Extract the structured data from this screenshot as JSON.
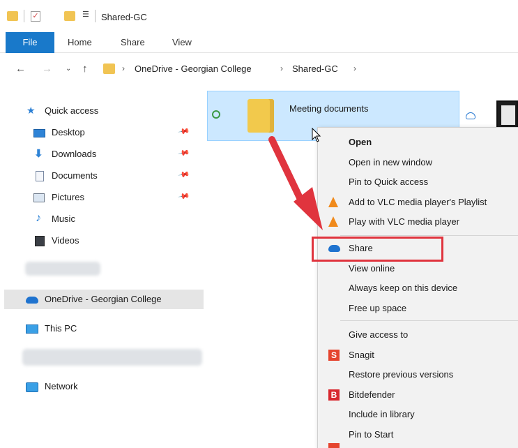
{
  "window": {
    "title": "Shared-GC"
  },
  "ribbon": {
    "tabs": [
      {
        "label": "File"
      },
      {
        "label": "Home"
      },
      {
        "label": "Share"
      },
      {
        "label": "View"
      }
    ]
  },
  "address": {
    "breadcrumbs": [
      "OneDrive - Georgian College",
      "Shared-GC"
    ]
  },
  "sidebar": {
    "items": [
      {
        "label": "Quick access",
        "icon": "star-icon"
      },
      {
        "label": "Desktop",
        "icon": "desktop-icon",
        "pinned": true
      },
      {
        "label": "Downloads",
        "icon": "download-icon",
        "pinned": true
      },
      {
        "label": "Documents",
        "icon": "documents-icon",
        "pinned": true
      },
      {
        "label": "Pictures",
        "icon": "pictures-icon",
        "pinned": true
      },
      {
        "label": "Music",
        "icon": "music-icon"
      },
      {
        "label": "Videos",
        "icon": "videos-icon"
      },
      {
        "label": "OneDrive - Georgian College",
        "icon": "onedrive-cloud-icon",
        "selected": true
      },
      {
        "label": "This PC",
        "icon": "pc-icon"
      },
      {
        "label": "Network",
        "icon": "network-icon"
      }
    ]
  },
  "content": {
    "files": [
      {
        "name": "Meeting documents",
        "type": "folder",
        "selected": true
      }
    ]
  },
  "context_menu": {
    "groups": [
      [
        {
          "label": "Open",
          "bold": true
        },
        {
          "label": "Open in new window"
        },
        {
          "label": "Pin to Quick access"
        },
        {
          "label": "Add to VLC media player's Playlist",
          "icon": "vlc-icon"
        },
        {
          "label": "Play with VLC media player",
          "icon": "vlc-icon"
        }
      ],
      [
        {
          "label": "Share",
          "icon": "onedrive-cloud-icon",
          "highlighted": true
        },
        {
          "label": "View online"
        },
        {
          "label": "Always keep on this device"
        },
        {
          "label": "Free up space"
        }
      ],
      [
        {
          "label": "Give access to"
        },
        {
          "label": "Snagit",
          "icon": "snagit-icon"
        },
        {
          "label": "Restore previous versions"
        },
        {
          "label": "Bitdefender",
          "icon": "bitdefender-icon"
        },
        {
          "label": "Include in library"
        },
        {
          "label": "Pin to Start"
        }
      ]
    ]
  },
  "colors": {
    "accent": "#1979ca",
    "selection": "#cce8ff",
    "highlight_box": "#e0343e",
    "annotation_arrow": "#e0343e"
  }
}
